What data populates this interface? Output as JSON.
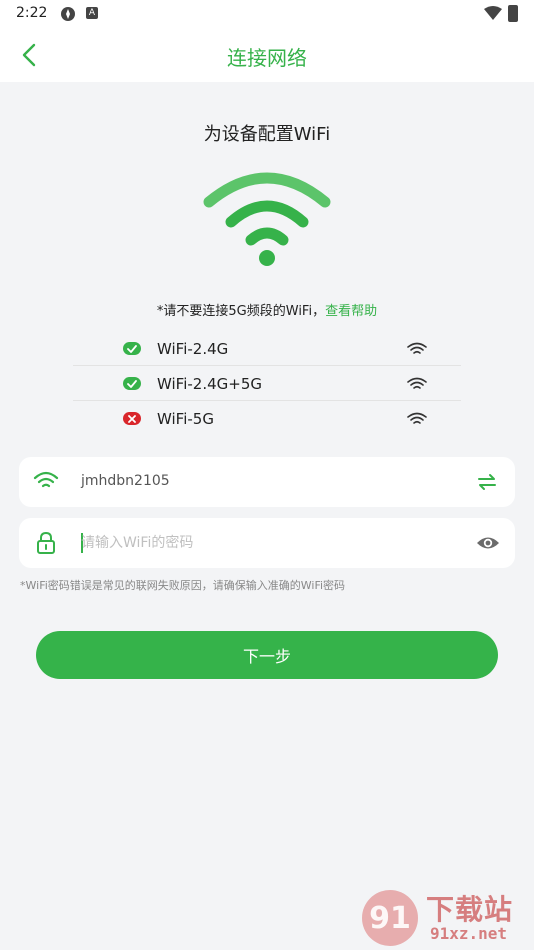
{
  "status_bar": {
    "time": "2:22",
    "badge_letter": "A"
  },
  "header": {
    "title": "连接网络"
  },
  "setup": {
    "heading": "为设备配置WiFi",
    "notice_text": "*请不要连接5G频段的WiFi，",
    "help_link": "查看帮助"
  },
  "bands": [
    {
      "label": "WiFi-2.4G",
      "supported": true
    },
    {
      "label": "WiFi-2.4G+5G",
      "supported": true
    },
    {
      "label": "WiFi-5G",
      "supported": false
    }
  ],
  "ssid_field": {
    "value": "jmhdbn2105"
  },
  "password_field": {
    "placeholder": "请输入WiFi的密码",
    "value": ""
  },
  "hint": "*WiFi密码错误是常见的联网失败原因，请确保输入准确的WiFi密码",
  "next_button": "下一步",
  "watermark": {
    "logo_mark": "91",
    "title": "下载站",
    "url": "91xz.net"
  },
  "colors": {
    "accent": "#36b24a",
    "error": "#d9262b",
    "background": "#f3f4f6"
  }
}
